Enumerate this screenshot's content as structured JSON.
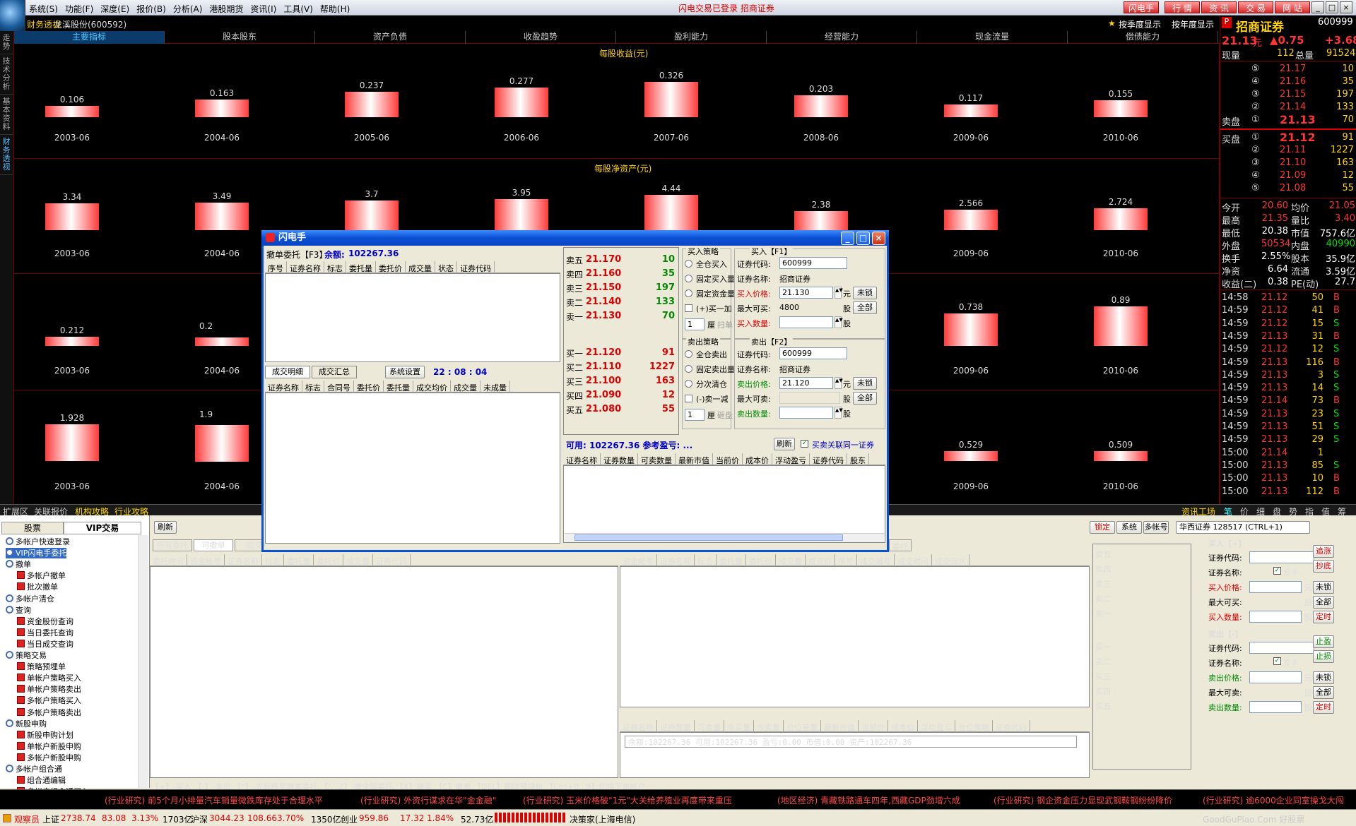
{
  "menu": [
    "系统(S)",
    "功能(F)",
    "深度(E)",
    "报价(B)",
    "分析(A)",
    "港股期货",
    "资讯(I)",
    "工具(V)",
    "帮助(H)"
  ],
  "login_status": "闪电交易已登录  招商证券",
  "top_buttons": [
    "闪电手",
    "行 情",
    "资 讯",
    "交 易",
    "网 站"
  ],
  "stock": {
    "mode": "财务透视",
    "name_code": "龙溪股份(600592)",
    "quarterly": "按季度显示",
    "annual": "按年度显示"
  },
  "side_tabs": [
    "走势",
    "技术分析",
    "基本资料",
    "财务透视"
  ],
  "f10_tabs": [
    "主要指标",
    "股本股东",
    "资产负债",
    "收盈趋势",
    "盈利能力",
    "经营能力",
    "现金流量",
    "偿债能力"
  ],
  "chart_data": [
    {
      "type": "bar",
      "title": "每股收益(元)",
      "categories": [
        "2003-06",
        "2004-06",
        "2005-06",
        "2006-06",
        "2007-06",
        "2008-06",
        "2009-06",
        "2010-06"
      ],
      "values": [
        0.106,
        0.163,
        0.237,
        0.277,
        0.326,
        0.203,
        0.117,
        0.155
      ],
      "ylim": [
        0,
        0.326
      ]
    },
    {
      "type": "bar",
      "title": "每股净资产(元)",
      "categories": [
        "2003-06",
        "2004-06",
        "2005-06",
        "2006-06",
        "2007-06",
        "2008-06",
        "2009-06",
        "2010-06"
      ],
      "values": [
        3.34,
        3.49,
        3.7,
        3.95,
        4.44,
        2.38,
        2.566,
        2.724
      ],
      "ylim": [
        0,
        4.44
      ]
    },
    {
      "type": "bar",
      "title": "",
      "categories": [
        "2003-06",
        "2004-06",
        "2009-06",
        "2010-06"
      ],
      "values": [
        0.212,
        null,
        0.738,
        0.89
      ],
      "ylim": [
        0,
        0.89
      ]
    },
    {
      "type": "bar",
      "title": "",
      "categories": [
        "2003-06",
        "2004-06",
        "2009-06",
        "2010-06"
      ],
      "values": [
        1.928,
        null,
        0.529,
        0.509
      ],
      "ylim": [
        0,
        1.928
      ]
    }
  ],
  "row3_partial": "0.2",
  "row4_partial": "1.9",
  "quote": {
    "broker": "招商证券",
    "code": "600999",
    "price": "21.13",
    "unit": "元",
    "change": "▲0.75",
    "pct": "+3.68",
    "now_label": "现量",
    "now_vol": "112",
    "total_label": "总量",
    "total_vol": "91524",
    "asks": [
      [
        "⑤",
        "21.17",
        "10"
      ],
      [
        "④",
        "21.16",
        "35"
      ],
      [
        "③",
        "21.15",
        "197"
      ],
      [
        "②",
        "21.14",
        "133"
      ],
      [
        "①",
        "21.13",
        "70"
      ]
    ],
    "ask_label": "卖盘",
    "bid_label": "买盘",
    "bids": [
      [
        "①",
        "21.12",
        "91"
      ],
      [
        "②",
        "21.11",
        "1227"
      ],
      [
        "③",
        "21.10",
        "163"
      ],
      [
        "④",
        "21.09",
        "12"
      ],
      [
        "⑤",
        "21.08",
        "55"
      ]
    ],
    "stats": [
      [
        "今开",
        "20.60",
        "均价",
        "21.05"
      ],
      [
        "最高",
        "21.35",
        "量比",
        "3.40"
      ],
      [
        "最低",
        "20.38",
        "市值",
        "757.6亿"
      ],
      [
        "外盘",
        "50534",
        "内盘",
        "40990"
      ],
      [
        "换手",
        "2.55%",
        "股本",
        "35.9亿"
      ],
      [
        "净资",
        "6.64",
        "流通",
        "3.59亿"
      ],
      [
        "收益(二)",
        "0.38",
        "PE(动)",
        "27.7"
      ]
    ],
    "ticks": [
      [
        "14:58",
        "21.12",
        "50",
        "B"
      ],
      [
        "14:59",
        "21.12",
        "41",
        "B"
      ],
      [
        "14:59",
        "21.12",
        "15",
        "S"
      ],
      [
        "14:59",
        "21.13",
        "31",
        "B"
      ],
      [
        "14:59",
        "21.12",
        "12",
        "S"
      ],
      [
        "14:59",
        "21.13",
        "116",
        "B"
      ],
      [
        "14:59",
        "21.13",
        "3",
        "S"
      ],
      [
        "14:59",
        "21.13",
        "14",
        "S"
      ],
      [
        "14:59",
        "21.14",
        "73",
        "B"
      ],
      [
        "14:59",
        "21.13",
        "23",
        "S"
      ],
      [
        "14:59",
        "21.13",
        "51",
        "S"
      ],
      [
        "14:59",
        "21.13",
        "29",
        "S"
      ],
      [
        "15:00",
        "21.14",
        "1",
        ""
      ],
      [
        "15:00",
        "21.13",
        "85",
        "S"
      ],
      [
        "15:00",
        "21.13",
        "10",
        "B"
      ],
      [
        "15:00",
        "21.13",
        "112",
        "B"
      ]
    ],
    "bottom_tabs": [
      "笔",
      "价",
      "细",
      "盘",
      "势",
      "指",
      "值",
      "筹"
    ]
  },
  "chart_bottom_tabs": [
    "扩展区",
    "关联报价",
    "机构攻略",
    "行业攻略"
  ],
  "info_tool": "资讯工场",
  "nav": {
    "tab1": "股票",
    "tab2": "VIP交易",
    "items": [
      "多帐户快速登录",
      "VIP闪电手委托",
      "撤单",
      "多帐户撤单",
      "批次撤单",
      "多帐户清仓",
      "查询",
      "资金股份查询",
      "当日委托查询",
      "当日成交查询",
      "策略交易",
      "策略预埋单",
      "单帐户策略买入",
      "单帐户策略卖出",
      "多帐户策略买入",
      "多帐户策略卖出",
      "新股申购",
      "新股申购计划",
      "单帐户新股申购",
      "多帐户新股申购",
      "多帐户组合通",
      "组合通编辑",
      "多帐户组合通买入"
    ]
  },
  "trade": {
    "refresh": "刷新",
    "tabs": [
      "所有委托",
      "可撤单",
      "成交"
    ],
    "hint_top": "【+】扫单 【-】砸盘 【F1】买入 【F2】卖出  【F3、*】光标移至撤单委托  【/、HOME】撤全部委托  【PAGE UP、X】撤买  【PAGE DOWN、C】撤卖",
    "hint_tail": "委托",
    "left_headers": [
      "委托时间",
      "资金帐号",
      "证券名称",
      "标志",
      "委托量",
      "委托价",
      "成交量",
      "证券代码"
    ],
    "right_headers": [
      "资金帐号",
      "证券名称",
      "标志",
      "委托量",
      "委托价",
      "成交量",
      "成交价",
      "序号",
      "成交编号",
      "成交时间",
      "成交流水"
    ],
    "pos_headers": [
      "证券名称",
      "证券数量",
      "可卖量",
      "今买量",
      "今卖量",
      "仓位差量",
      "最新市值",
      "当前价",
      "成本价",
      "浮动盈亏",
      "仓位策略",
      "证券代码"
    ],
    "summary": "余额:102267.36  可用:102267.36  盈亏:0.00  市值:0.00  资产:102267.36",
    "hint_bottom": "【+】-买入  【-】-卖出  【*】-光标移至撤单委托  【/、Z】-撤全部委托  【X】撤买  【C】撤卖  【DEL】删除预埋单  【Ctrl+0...9】切换下单帐户",
    "ladder_asks": [
      "卖五",
      "卖四",
      "卖三",
      "卖二",
      "卖一"
    ],
    "ladder_bids": [
      "买一",
      "买二",
      "买三",
      "买四",
      "买五"
    ],
    "toolbar": [
      "锁定",
      "系统",
      "多帐号"
    ],
    "account": "华西证券 128517 (CTRL+1)",
    "buy_title": "买入【+】",
    "sell_title": "卖出【-】",
    "code_label": "证券代码:",
    "name_label": "证券名称:",
    "reverse": "反手",
    "buy_price": "买入价格:",
    "max_buy": "最大可买:",
    "buy_qty": "买入数量:",
    "sell_price": "卖出价格:",
    "max_sell": "最大可卖:",
    "sell_qty": "卖出数量:",
    "yuan": "元",
    "shares": "股",
    "unlock": "未锁",
    "all": "全部",
    "timed": "定时",
    "side_buy": [
      "追涨",
      "抄底"
    ],
    "side_sell": [
      "止盈",
      "止损"
    ]
  },
  "dialog": {
    "title": "闪电手",
    "cancel_title": "撤单委托【F3】",
    "balance_label": "余额:",
    "balance": "102267.36",
    "order_headers": [
      "序号",
      "证券名称",
      "标志",
      "委托量",
      "委托价",
      "成交量",
      "状态",
      "证券代码"
    ],
    "detail_tab": "成交明细",
    "summary_tab": "成交汇总",
    "settings": "系统设置",
    "time": "22 : 08 : 04",
    "deal_headers": [
      "证券名称",
      "标志",
      "合同号",
      "委托价",
      "委托量",
      "成交均价",
      "成交量",
      "未成量"
    ],
    "asks": [
      [
        "卖五",
        "21.170",
        "10"
      ],
      [
        "卖四",
        "21.160",
        "35"
      ],
      [
        "卖三",
        "21.150",
        "197"
      ],
      [
        "卖二",
        "21.140",
        "133"
      ],
      [
        "卖一",
        "21.130",
        "70"
      ]
    ],
    "bids": [
      [
        "买一",
        "21.120",
        "91"
      ],
      [
        "买二",
        "21.110",
        "1227"
      ],
      [
        "买三",
        "21.100",
        "163"
      ],
      [
        "买四",
        "21.090",
        "12"
      ],
      [
        "买五",
        "21.080",
        "55"
      ]
    ],
    "buy_strategy": "买入策略",
    "buy_opts": [
      "全仓买入",
      "固定买入量",
      "固定资金量",
      "(+)买一加"
    ],
    "buy_lot": "1",
    "lot_unit": "厘",
    "buy_sweep": "扫单",
    "buy_box": "买入【F1】",
    "code_label": "证券代码:",
    "code": "600999",
    "name_label": "证券名称:",
    "name": "招商证券",
    "buy_price_label": "买入价格:",
    "buy_price": "21.130",
    "yuan": "元",
    "unlock": "未锁",
    "max_buy_label": "最大可买:",
    "max_buy": "4800",
    "shares": "股",
    "all": "全部",
    "buy_qty_label": "买入数量:",
    "sell_strategy": "卖出策略",
    "sell_opts": [
      "全仓卖出",
      "固定卖出量",
      "分次清仓",
      "(-)卖一减"
    ],
    "sell_lot": "1",
    "sell_sweep": "砸盘",
    "sell_box": "卖出【F2】",
    "sell_price_label": "卖出价格:",
    "sell_price": "21.120",
    "max_sell_label": "最大可卖:",
    "sell_qty_label": "卖出数量:",
    "available": "可用: 102267.36 参考盈亏: ...",
    "refresh": "刷新",
    "link": "买卖关联同一证券",
    "pos_headers": [
      "证券名称",
      "证券数量",
      "可卖数量",
      "最新市值",
      "当前价",
      "成本价",
      "浮动盈亏",
      "证券代码",
      "股东"
    ]
  },
  "ticker": [
    "(行业研究)  前5个月小排量汽车销量微跌库存处于合理水平",
    "(行业研究)  外资行谋求在华\"金金融\"",
    "(行业研究)  玉米价格破\"1元\"大关给养殖业再度带来重压",
    "(地区经济)  青藏铁路通车四年,西藏GDP劲增六成",
    "(行业研究)  钢企资金压力显现武钢鞍钢纷纷降价",
    "(行业研究)  逾6000企业同室操戈大闯"
  ],
  "statusbar": {
    "user": "观察员",
    "sh_label": "上证",
    "sh": "2738.74",
    "sh_chg": "83.08",
    "sh_pct": "3.13%",
    "sh_amt": "1703亿",
    "sz_label": "沪深",
    "sz": "3044.23",
    "sz_chg": "108.66",
    "sz_pct": "3.70%",
    "sz_amt": "1350亿",
    "cy_label": "创业",
    "cy": "959.86",
    "cy_chg": "17.32",
    "cy_pct": "1.84%",
    "cy_amt": "52.73亿",
    "server": "决策家(上海电信)",
    "watermark": "GoodGuPiao.Com 好股票"
  }
}
